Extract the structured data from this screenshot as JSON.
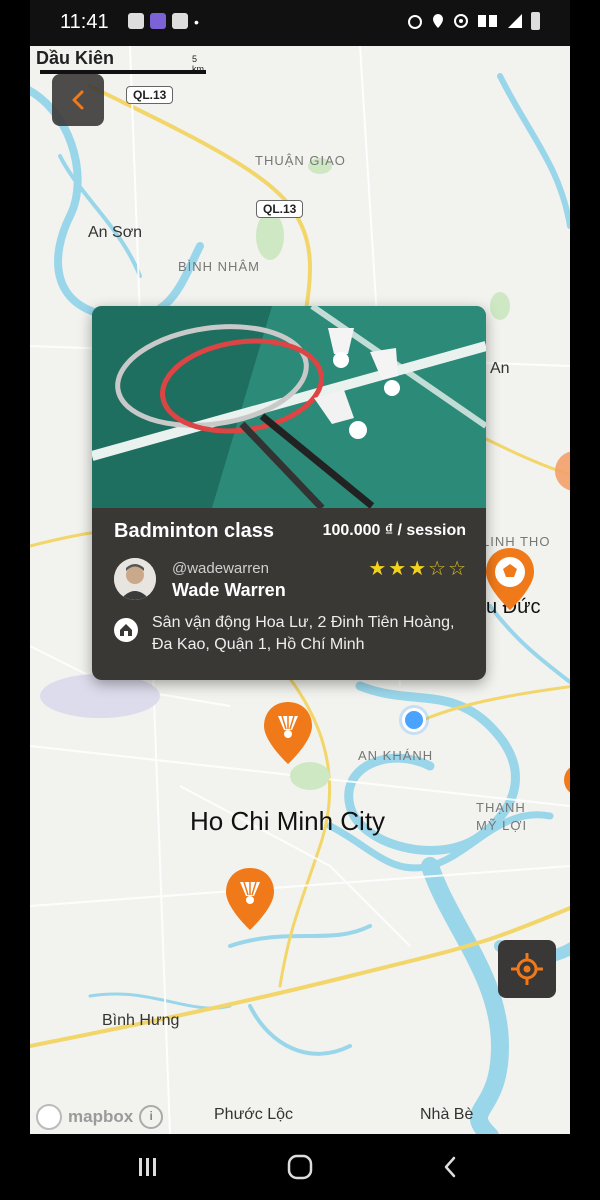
{
  "status_bar": {
    "time": "11:41",
    "dot": "•"
  },
  "map": {
    "scale": {
      "text": "Dầu Kiên",
      "unit": "5 km"
    },
    "labels": {
      "thuan_giao": "THUẬN GIAO",
      "an_son": "An Sơn",
      "binh_nham": "BÌNH NHÂM",
      "an": "An",
      "linh_tho": "LINH THO",
      "duc": "u Đức",
      "an_khanh": "AN KHÁNH",
      "hcmc": "Ho Chi Minh City",
      "thanh_my_loi_1": "THẠNH",
      "thanh_my_loi_2": "MỸ LỢI",
      "binh_hung": "Bình Hưng",
      "phuoc_loc": "Phước Lộc",
      "nha_be": "Nhà Bè"
    },
    "road_badges": [
      "QL.13",
      "QL.13"
    ],
    "attribution": "mapbox",
    "attribution_info": "i"
  },
  "card": {
    "title": "Badminton class",
    "price": "100.000 ₫ / session",
    "handle": "@wadewarren",
    "name": "Wade Warren",
    "rating": 3,
    "stars_max": 5,
    "star_on": "★",
    "star_off": "☆",
    "address": "Sân vận động Hoa Lư, 2 Đinh Tiên Hoàng, Đa Kao, Quận 1, Hồ Chí Minh"
  },
  "colors": {
    "accent": "#f07a1a",
    "card_bg": "#3a3835",
    "star": "#f2d21b",
    "river": "#8fd3e8"
  },
  "icons": {
    "back": "chevron-left-icon",
    "locate": "crosshair-icon",
    "pin_badminton": "shuttlecock-icon",
    "pin_football": "football-icon"
  }
}
